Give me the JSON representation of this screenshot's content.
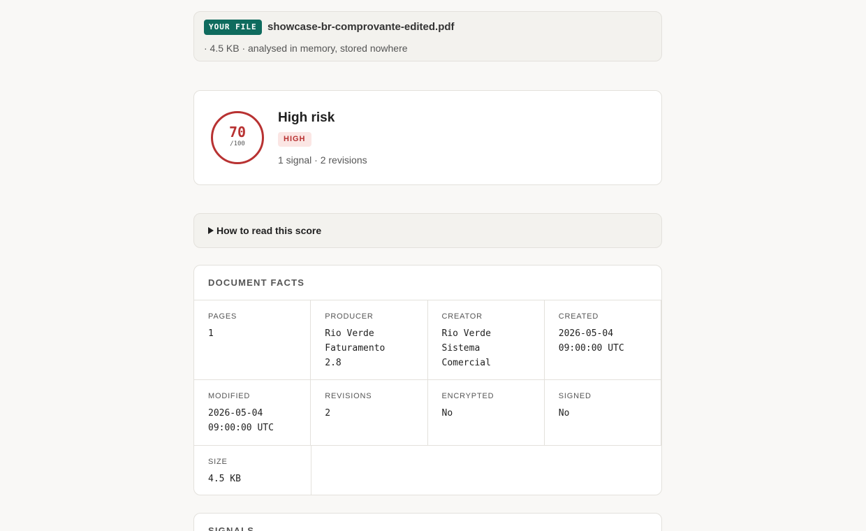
{
  "file": {
    "badge": "YOUR FILE",
    "name": "showcase-br-comprovante-edited.pdf",
    "meta": "· 4.5 KB · analysed in memory, stored nowhere"
  },
  "score": {
    "value": "70",
    "max": "/100",
    "title": "High risk",
    "level_badge": "HIGH",
    "summary": "1 signal · 2 revisions",
    "color": "#b83232"
  },
  "howto": {
    "label": "How to read this score",
    "icon": "triangle-right-icon"
  },
  "facts": {
    "heading": "DOCUMENT FACTS",
    "items": [
      {
        "label": "PAGES",
        "value": "1"
      },
      {
        "label": "PRODUCER",
        "value": "Rio Verde\nFaturamento\n2.8"
      },
      {
        "label": "CREATOR",
        "value": "Rio Verde\nSistema\nComercial"
      },
      {
        "label": "CREATED",
        "value": "2026-05-04\n09:00:00 UTC"
      },
      {
        "label": "MODIFIED",
        "value": "2026-05-04\n09:00:00 UTC"
      },
      {
        "label": "REVISIONS",
        "value": "2"
      },
      {
        "label": "ENCRYPTED",
        "value": "No"
      },
      {
        "label": "SIGNED",
        "value": "No"
      },
      {
        "label": "SIZE",
        "value": "4.5 KB"
      }
    ]
  },
  "signals": {
    "heading": "SIGNALS"
  },
  "colors": {
    "accent": "#0f6b5e",
    "danger": "#b83232",
    "background": "#f9f8f6"
  }
}
